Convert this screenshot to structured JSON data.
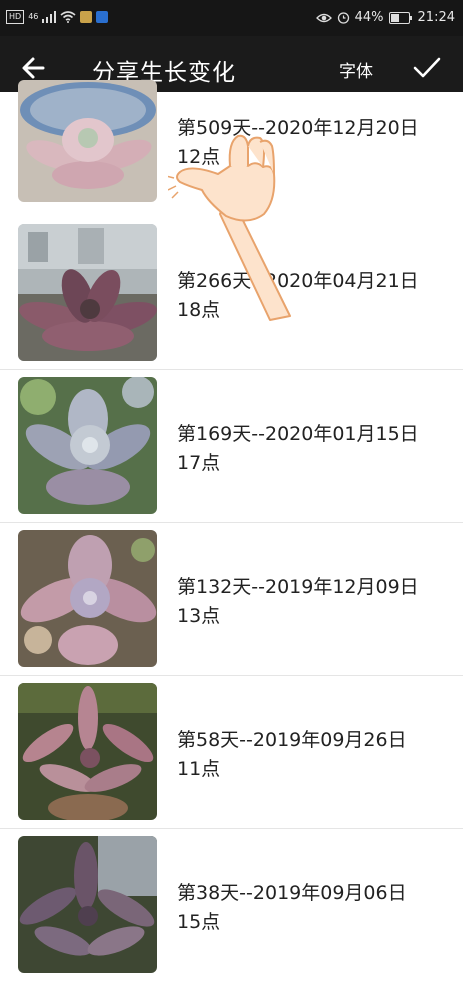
{
  "status_bar": {
    "left_icons": [
      "hd-icon",
      "signal-icon",
      "wifi-icon",
      "app-notification-icon",
      "shield-icon"
    ],
    "hd_label": "HD",
    "net_label": "46",
    "battery": "44%",
    "time": "21:24"
  },
  "app_bar": {
    "title": "分享生长变化",
    "font_button": "字体",
    "back_icon": "arrow-left-icon",
    "confirm_icon": "checkmark-icon"
  },
  "entries": [
    {
      "day": "第509天--2020年12月20日",
      "time": "12点"
    },
    {
      "day": "第266天--2020年04月21日",
      "time": "18点"
    },
    {
      "day": "第169天--2020年01月15日",
      "time": "17点"
    },
    {
      "day": "第132天--2019年12月09日",
      "time": "13点"
    },
    {
      "day": "第58天--2019年09月26日",
      "time": "11点"
    },
    {
      "day": "第38天--2019年09月06日",
      "time": "15点"
    }
  ],
  "colors": {
    "app_bar": "#1b1b1b",
    "status_bar": "#161616",
    "divider": "#e5e5e5",
    "text": "#222222"
  }
}
